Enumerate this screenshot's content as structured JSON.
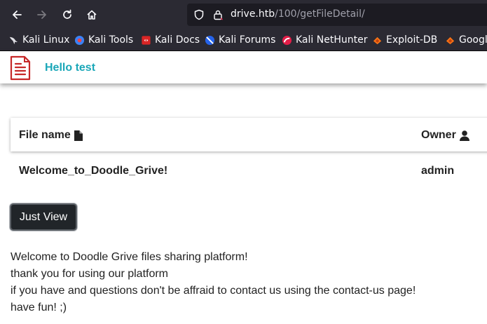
{
  "browser": {
    "url_host": "drive.htb",
    "url_path": "/100/getFileDetail/",
    "bookmarks": [
      {
        "label": "Kali Linux",
        "icon": "kali-dragon-icon"
      },
      {
        "label": "Kali Tools",
        "icon": "kali-tools-icon"
      },
      {
        "label": "Kali Docs",
        "icon": "kali-docs-icon"
      },
      {
        "label": "Kali Forums",
        "icon": "kali-forums-icon"
      },
      {
        "label": "Kali NetHunter",
        "icon": "kali-nethunter-icon"
      },
      {
        "label": "Exploit-DB",
        "icon": "exploit-db-icon"
      },
      {
        "label": "Googl",
        "icon": "exploit-db-icon"
      }
    ]
  },
  "navbar": {
    "greeting": "Hello test",
    "logo_icon": "document-icon"
  },
  "table": {
    "headers": {
      "file_name": "File name",
      "owner": "Owner"
    },
    "rows": [
      {
        "file_name": "Welcome_to_Doodle_Grive!",
        "owner": "admin"
      }
    ]
  },
  "actions": {
    "view_label": "Just View"
  },
  "file_content": {
    "lines": [
      "Welcome to Doodle Grive files sharing platform!",
      "thank you for using our platform",
      "if you have and questions don't be affraid to contact us using the contact-us page!",
      "have fun! ;)"
    ]
  },
  "colors": {
    "accent": "#1aa7b8",
    "logo": "#c62828",
    "button": "#212529"
  }
}
